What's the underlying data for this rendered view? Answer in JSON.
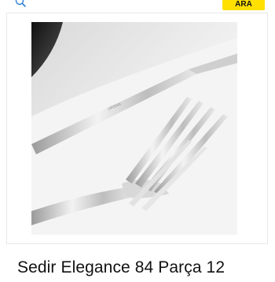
{
  "search": {
    "placeholder": "",
    "button_label": "ARA",
    "icon": "search-icon",
    "accent_color": "#ffe000"
  },
  "product": {
    "image": "cutlery-set-photo",
    "image_alt": "Sedir Elegance cutlery",
    "title": "Sedir Elegance 84 Parça 12"
  }
}
